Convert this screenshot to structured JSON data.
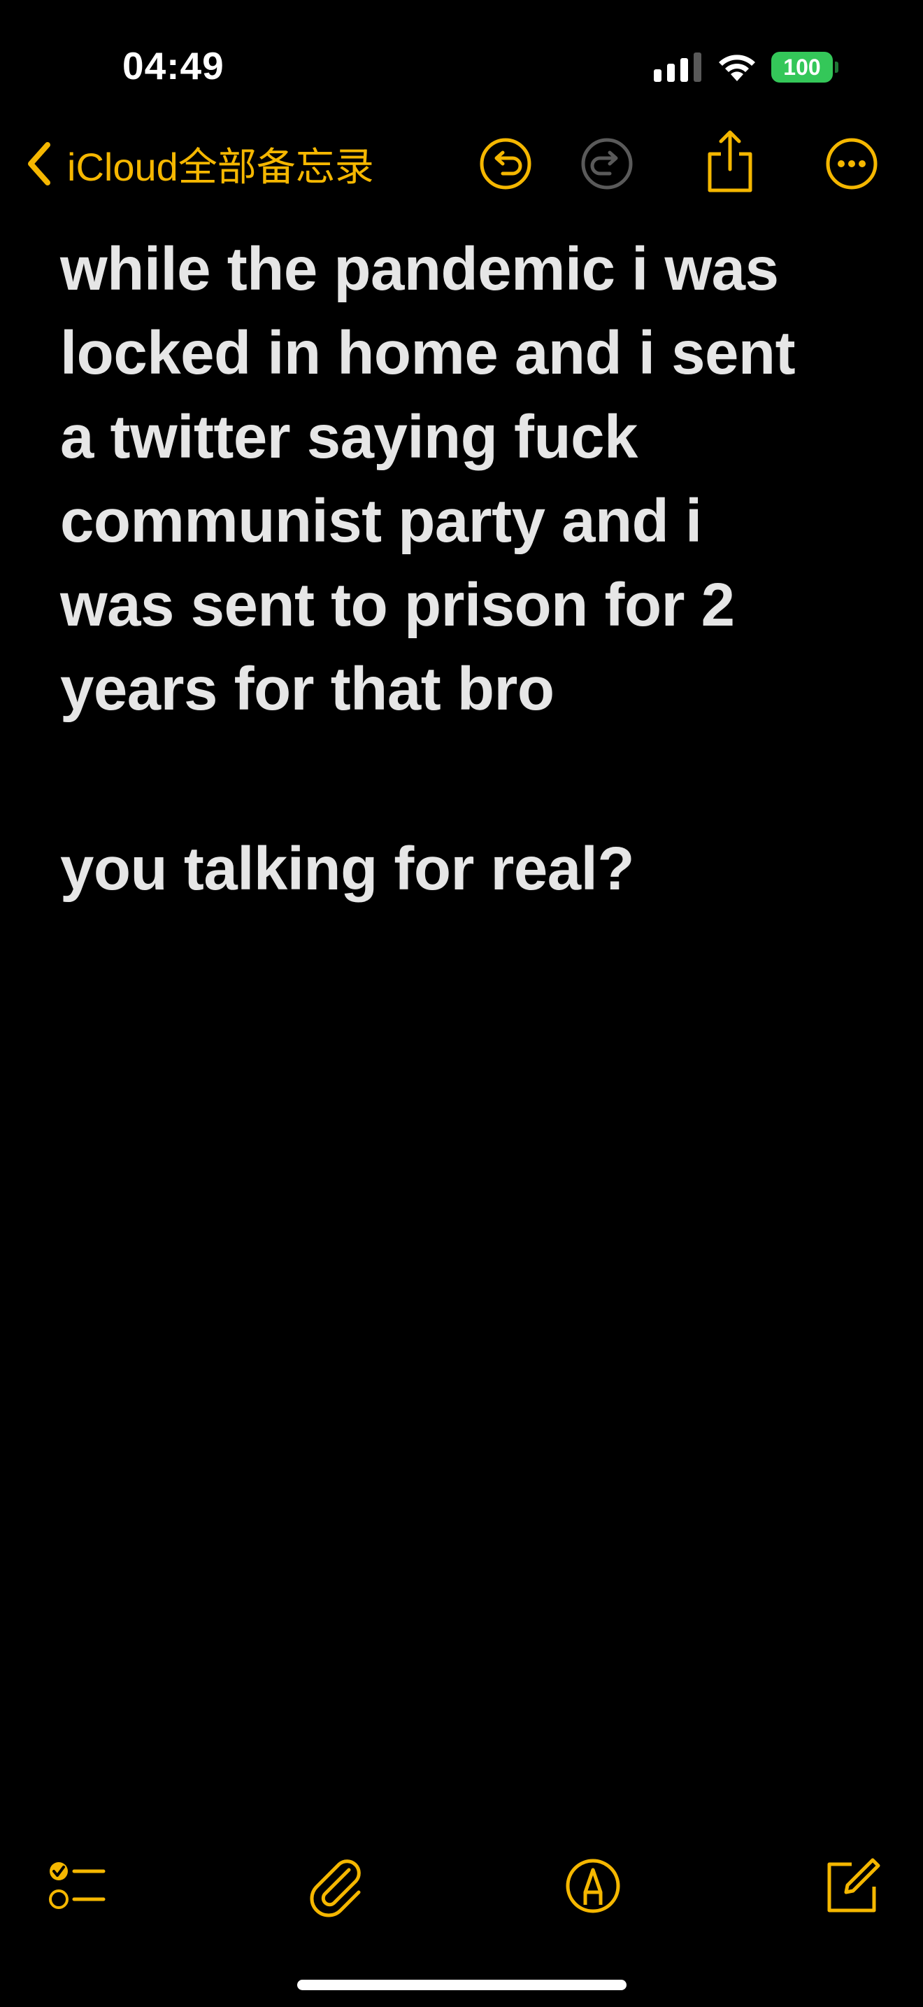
{
  "status_bar": {
    "time": "04:49",
    "battery": "100",
    "battery_color": "#34c759"
  },
  "nav": {
    "back_label": "iCloud全部备忘录",
    "accent_color": "#f5b700",
    "icons": [
      "chevron-left-icon",
      "undo-icon",
      "redo-icon",
      "share-icon",
      "more-icon"
    ]
  },
  "note": {
    "lines": [
      "while the pandemic i was",
      "locked in home and i sent",
      "a twitter saying fuck",
      "communist party and i",
      "was sent to prison for 2",
      "years for that bro"
    ],
    "reply": "you talking for real?"
  },
  "toolbar": {
    "icons": [
      "checklist-icon",
      "paperclip-icon",
      "markup-pen-icon",
      "compose-icon"
    ]
  }
}
